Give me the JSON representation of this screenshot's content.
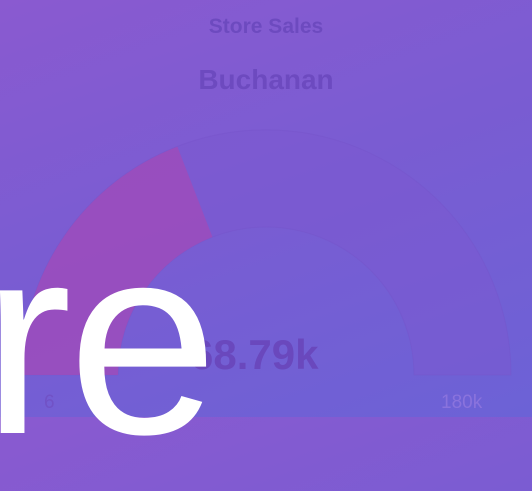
{
  "card": {
    "title": "Store Sales",
    "subtitle": "Buchanan",
    "value_text": "68.79k",
    "min_text": "6",
    "max_text": "180k"
  },
  "overlay": {
    "text": "re"
  },
  "chart_data": {
    "type": "gauge",
    "title": "Store Sales",
    "subtitle": "Buchanan",
    "value": 68790,
    "max": 180000,
    "value_label": "68.79k",
    "max_label": "180k"
  },
  "colors": {
    "band_track": "#7b58cf",
    "band_fill": "#a14bb8",
    "text": "#6a48bd"
  }
}
